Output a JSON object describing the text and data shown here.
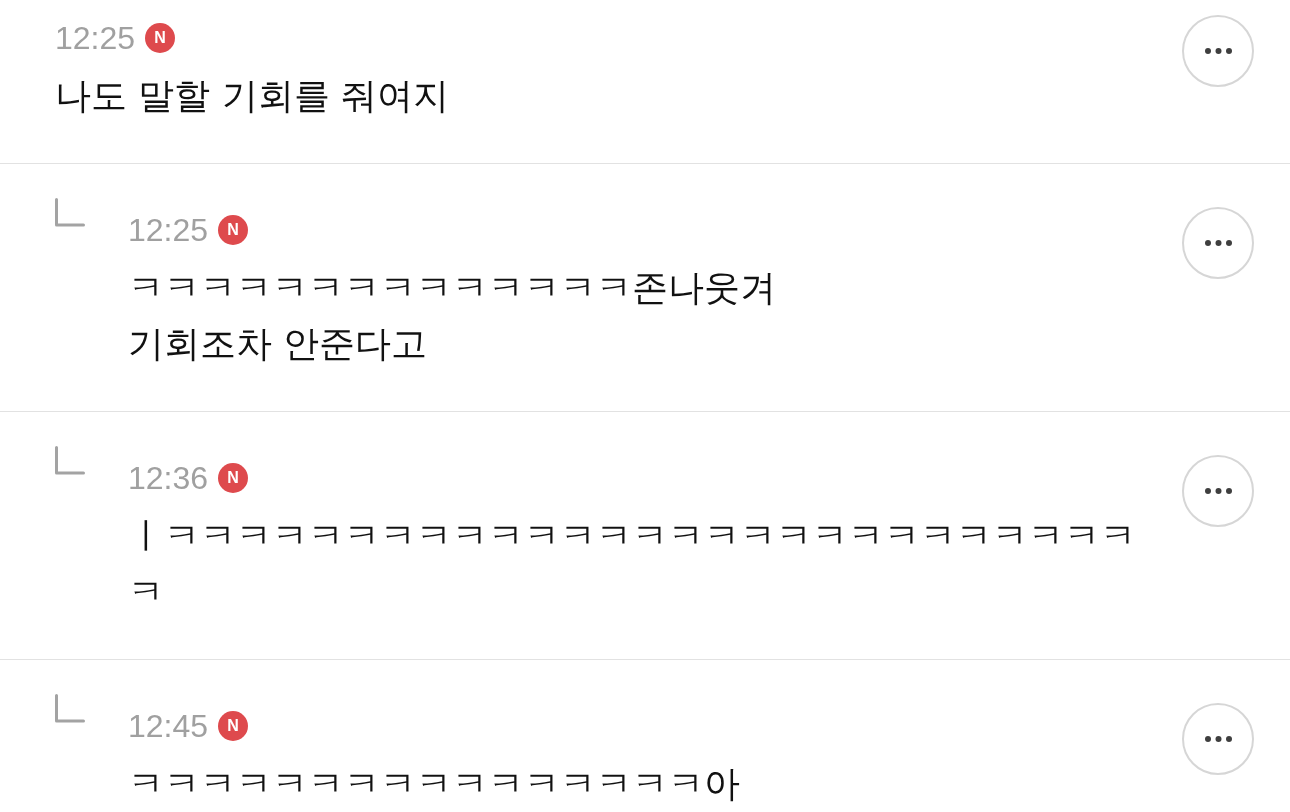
{
  "comments": [
    {
      "kind": "comment",
      "time": "12:25",
      "badge": "N",
      "text": "나도 말할 기회를 줘여지"
    },
    {
      "kind": "reply",
      "time": "12:25",
      "badge": "N",
      "text": "ㅋㅋㅋㅋㅋㅋㅋㅋㅋㅋㅋㅋㅋㅋ존나웃겨\n기회조차 안준다고"
    },
    {
      "kind": "reply",
      "time": "12:36",
      "badge": "N",
      "text": "ㅣㅋㅋㅋㅋㅋㅋㅋㅋㅋㅋㅋㅋㅋㅋㅋㅋㅋㅋㅋㅋㅋㅋㅋㅋㅋㅋㅋㅋ"
    },
    {
      "kind": "reply",
      "time": "12:45",
      "badge": "N",
      "text": "ㅋㅋㅋㅋㅋㅋㅋㅋㅋㅋㅋㅋㅋㅋㅋㅋ아"
    }
  ]
}
